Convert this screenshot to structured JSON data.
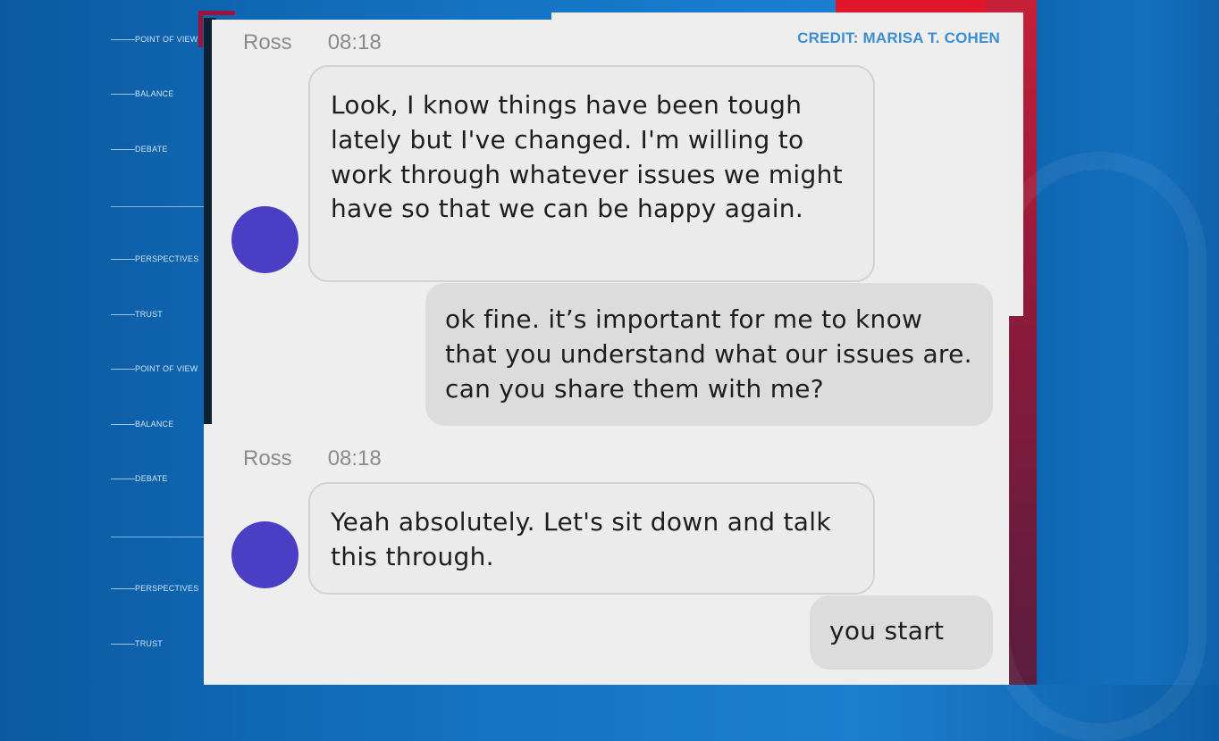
{
  "sidebar": {
    "items": [
      {
        "label": "POINT OF VIEW"
      },
      {
        "label": "BALANCE"
      },
      {
        "label": "DEBATE"
      },
      {
        "label": "PERSPECTIVES"
      },
      {
        "label": "TRUST"
      },
      {
        "label": "POINT OF VIEW"
      },
      {
        "label": "BALANCE"
      },
      {
        "label": "DEBATE"
      },
      {
        "label": "PERSPECTIVES"
      },
      {
        "label": "TRUST"
      }
    ]
  },
  "credit": "CREDIT: MARISA T. COHEN",
  "messages": [
    {
      "sender": "Ross",
      "time": "08:18",
      "text": "Look, I know things have been tough lately but I've changed. I'm willing to work through whatever issues we might have so that we can be happy again."
    },
    {
      "text": "ok fine. it’s important for me to know that you understand what our issues are. can you share them with me?"
    },
    {
      "sender": "Ross",
      "time": "08:18",
      "text": "Yeah absolutely. Let's sit down and talk this through."
    },
    {
      "text": "you start"
    }
  ],
  "colors": {
    "avatar": "#4a3fc4",
    "credit": "#3d8fd1",
    "background_blue": "#1473c3",
    "accent_red": "#c61f38"
  }
}
